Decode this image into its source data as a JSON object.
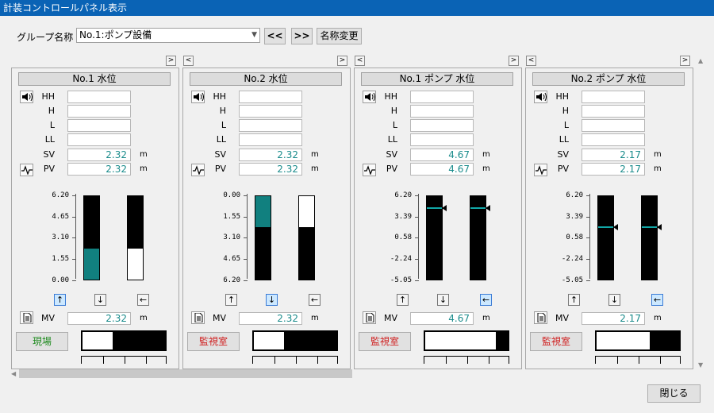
{
  "window": {
    "title": "計装コントロールパネル表示"
  },
  "group": {
    "label": "グループ名称",
    "selected": "No.1:ポンプ設備",
    "prev_label": "<<",
    "next_label": ">>",
    "rename_label": "名称変更"
  },
  "nav": {
    "left": "<",
    "right": ">"
  },
  "row_labels": [
    "HH",
    "H",
    "L",
    "LL",
    "SV",
    "PV"
  ],
  "mv_label": "MV",
  "unit": "m",
  "controls": {
    "up": "↑",
    "down": "↓",
    "left": "←"
  },
  "panels": [
    {
      "title": "No.1 水位",
      "hh": "",
      "h": "",
      "l": "",
      "ll": "",
      "sv": "2.32",
      "pv": "2.32",
      "mv": "2.32",
      "scale": [
        "6.20",
        "4.65",
        "3.10",
        "1.55",
        "0.00"
      ],
      "pv_level": 0.374,
      "sv_level": null,
      "mv_level": 0.374,
      "fill_from": "bottom",
      "active_btn": "up",
      "mode": "現場",
      "mode_color": "#1e8a1e",
      "out_white": 0.37
    },
    {
      "title": "No.2 水位",
      "hh": "",
      "h": "",
      "l": "",
      "ll": "",
      "sv": "2.32",
      "pv": "2.32",
      "mv": "2.32",
      "scale": [
        "0.00",
        "1.55",
        "3.10",
        "4.65",
        "6.20"
      ],
      "pv_level": 0.374,
      "sv_level": null,
      "mv_level": 0.374,
      "fill_from": "top",
      "active_btn": "down",
      "mode": "監視室",
      "mode_color": "#d02020",
      "out_white": 0.37
    },
    {
      "title": "No.1 ポンプ 水位",
      "hh": "",
      "h": "",
      "l": "",
      "ll": "",
      "sv": "4.67",
      "pv": "4.67",
      "mv": "4.67",
      "scale": [
        "6.20",
        "3.39",
        "0.58",
        "-2.24",
        "-5.05"
      ],
      "pv_level": 0.864,
      "sv_level": 0.864,
      "mv_level": 0.864,
      "fill_from": "none",
      "active_btn": "left",
      "mode": "監視室",
      "mode_color": "#d02020",
      "out_white": 0.86
    },
    {
      "title": "No.2 ポンプ 水位",
      "hh": "",
      "h": "",
      "l": "",
      "ll": "",
      "sv": "2.17",
      "pv": "2.17",
      "mv": "2.17",
      "scale": [
        "6.20",
        "3.39",
        "0.58",
        "-2.24",
        "-5.05"
      ],
      "pv_level": 0.642,
      "sv_level": 0.642,
      "mv_level": 0.642,
      "fill_from": "none",
      "active_btn": "left",
      "mode": "監視室",
      "mode_color": "#d02020",
      "out_white": 0.64
    }
  ],
  "close_label": "閉じる",
  "colors": {
    "accent": "#0a63b5",
    "fill": "#11807f",
    "value_text": "#1b8c8c"
  }
}
